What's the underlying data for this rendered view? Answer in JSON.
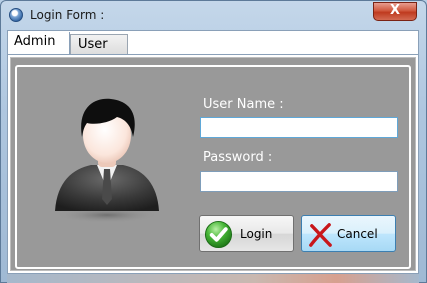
{
  "window": {
    "title": "Login Form :"
  },
  "tabs": [
    {
      "label": "Admin",
      "active": true
    },
    {
      "label": "User",
      "active": false
    }
  ],
  "form": {
    "username_label": "User Name :",
    "username_value": "",
    "password_label": "Password :",
    "password_value": ""
  },
  "buttons": {
    "login_label": "Login",
    "cancel_label": "Cancel",
    "close_glyph": "X"
  },
  "icons": {
    "app": "app-icon",
    "avatar": "user-avatar-icon",
    "login": "checkmark-icon",
    "cancel": "cross-icon"
  },
  "colors": {
    "panel_bg": "#999999",
    "label_text": "#ffffff",
    "close_button": "#c7432a",
    "cancel_highlight": "#bee6fd"
  }
}
